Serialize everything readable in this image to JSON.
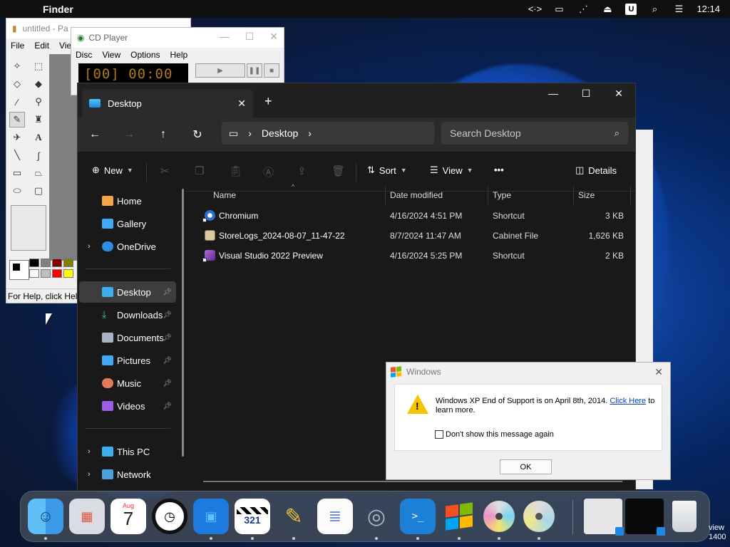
{
  "menubar": {
    "app_name": "Finder",
    "clock": "12:14",
    "u_badge": "U",
    "icons": [
      "code-icon",
      "display-icon",
      "mute-icon",
      "eject-icon",
      "u-icon",
      "search-icon",
      "control-center-icon"
    ]
  },
  "paint": {
    "title": "untitled - Pa",
    "menu": [
      "File",
      "Edit",
      "View"
    ],
    "status": "For Help, click Hel"
  },
  "cdplayer": {
    "title": "CD Player",
    "menu": [
      "Disc",
      "View",
      "Options",
      "Help"
    ],
    "display": "[00] 00:00"
  },
  "explorer": {
    "tab_title": "Desktop",
    "address_path": "Desktop",
    "search_placeholder": "Search Desktop",
    "toolbar": {
      "new": "New",
      "sort": "Sort",
      "view": "View",
      "more": "•••",
      "details": "Details"
    },
    "nav": {
      "home": "Home",
      "gallery": "Gallery",
      "onedrive": "OneDrive",
      "desktop": "Desktop",
      "downloads": "Downloads",
      "documents": "Documents",
      "pictures": "Pictures",
      "music": "Music",
      "videos": "Videos",
      "thispc": "This PC",
      "network": "Network"
    },
    "columns": {
      "name": "Name",
      "date": "Date modified",
      "type": "Type",
      "size": "Size"
    },
    "files": [
      {
        "name": "Chromium",
        "date": "4/16/2024 4:51 PM",
        "type": "Shortcut",
        "size": "3 KB"
      },
      {
        "name": "StoreLogs_2024-08-07_11-47-22",
        "date": "8/7/2024 11:47 AM",
        "type": "Cabinet File",
        "size": "1,626 KB"
      },
      {
        "name": "Visual Studio 2022 Preview",
        "date": "4/16/2024 5:25 PM",
        "type": "Shortcut",
        "size": "2 KB"
      }
    ]
  },
  "dialog": {
    "title": "Windows",
    "message_pre": "Windows XP End of Support is on April 8th, 2014.",
    "link": "Click Here",
    "message_post": "to learn more.",
    "checkbox": "Don't show this message again",
    "ok": "OK"
  },
  "dock": {
    "calendar_month": "Aug",
    "calendar_day": "7",
    "clapper_text": "321"
  },
  "corner_text": {
    "line1": "view",
    "line2": "1400"
  }
}
